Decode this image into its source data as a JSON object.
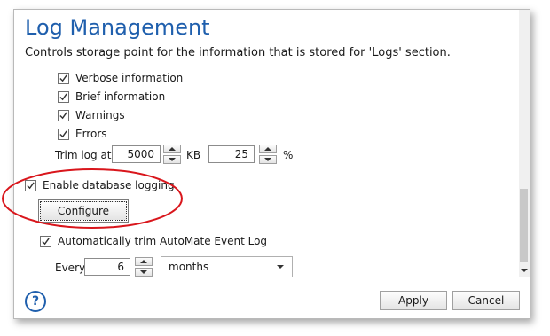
{
  "header": {
    "title": "Log Management",
    "subtitle": "Controls storage point for the information that is stored for 'Logs' section."
  },
  "options": [
    {
      "label": "Verbose information",
      "checked": true
    },
    {
      "label": "Brief information",
      "checked": true
    },
    {
      "label": "Warnings",
      "checked": true
    },
    {
      "label": "Errors",
      "checked": true
    }
  ],
  "trim": {
    "label": "Trim log at:",
    "size_value": "5000",
    "size_unit": "KB",
    "percent_value": "25",
    "percent_unit": "%"
  },
  "database": {
    "label": "Enable database logging",
    "checked": true,
    "configure_label": "Configure"
  },
  "autotrim": {
    "label": "Automatically trim AutoMate Event Log",
    "checked": true,
    "every_label": "Every",
    "every_value": "6",
    "period_selected": "months"
  },
  "footer": {
    "help_icon": "?",
    "apply_label": "Apply",
    "cancel_label": "Cancel"
  },
  "colors": {
    "accent": "#1f5fad",
    "annotation": "#d9161c"
  }
}
